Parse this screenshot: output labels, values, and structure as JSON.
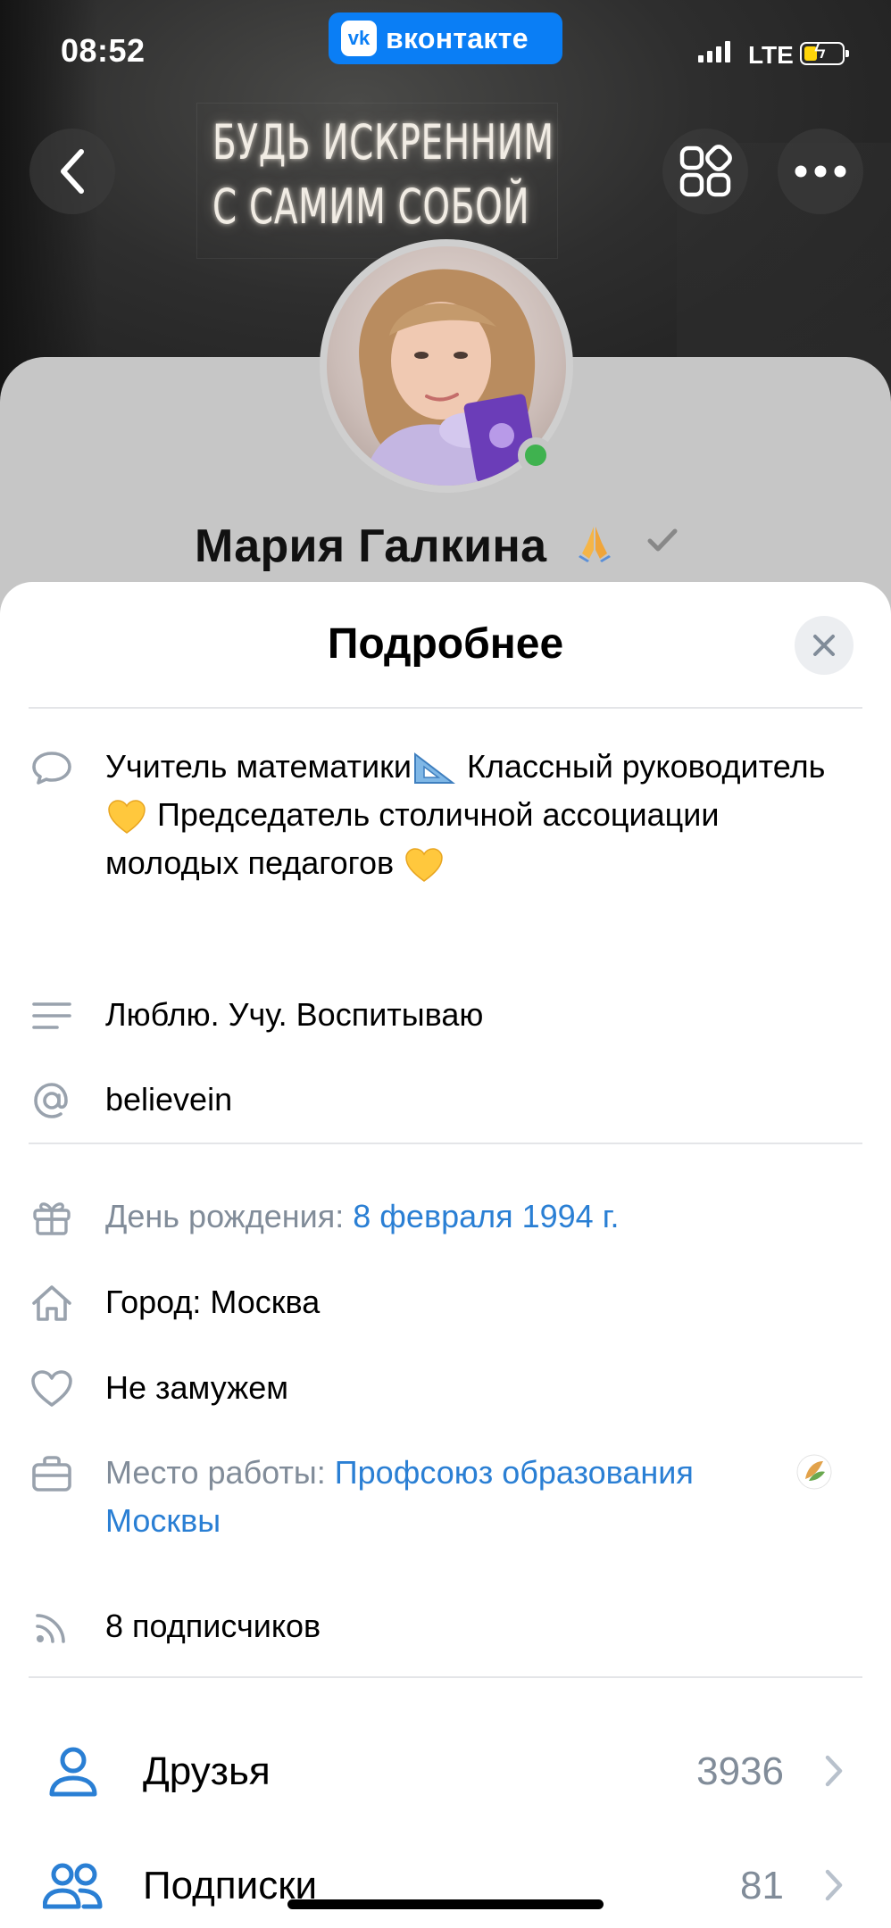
{
  "status_bar": {
    "time": "08:52",
    "app_badge": "вконтакте",
    "network": "LTE"
  },
  "cover": {
    "neon_line_1": "БУДЬ ИСКРЕННИМ",
    "neon_line_2": "С САМИМ СОБОЙ"
  },
  "header": {
    "back_icon": "chevron-left-icon",
    "apps_icon": "grid-icon",
    "more_icon": "ellipsis-icon"
  },
  "profile": {
    "name": "Мария Галкина",
    "status_emoji": "🙏",
    "online": true
  },
  "sheet": {
    "title": "Подробнее",
    "status_text_part1": "Учитель математики",
    "status_text_part2": " Классный руководитель ",
    "status_text_part3": " Председатель столичной ассоциации молодых педагогов ",
    "about": "Люблю. Учу. Воспитываю",
    "short_link": "believein",
    "birthday_label": "День рождения: ",
    "birthday_value": "8 февраля 1994 г.",
    "city_label": "Город: Москва",
    "relationship": "Не замужем",
    "work_label": "Место работы: ",
    "work_value_1": "Профсоюз образования",
    "work_value_2": "Москвы",
    "followers": "8 подписчиков"
  },
  "nav": [
    {
      "label": "Друзья",
      "count": "3936"
    },
    {
      "label": "Подписки",
      "count": "81"
    }
  ],
  "colors": {
    "accent": "#2a7fd4",
    "vk_blue": "#0a7ef5",
    "muted": "#818c99",
    "online": "#3fb24f"
  }
}
